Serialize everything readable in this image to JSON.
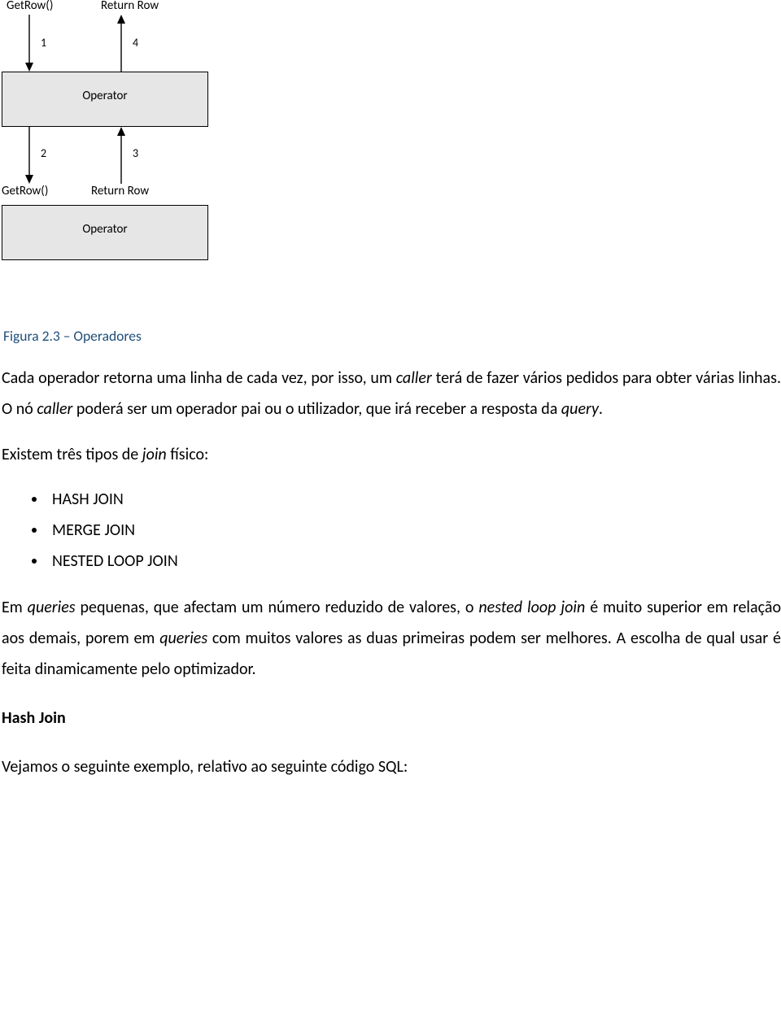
{
  "diagram": {
    "top_labels": {
      "left": "GetRow()",
      "right": "Return Row"
    },
    "mid_labels": {
      "left": "GetRow()",
      "right": "Return Row"
    },
    "op1": "Operator",
    "op2": "Operator",
    "n1": "1",
    "n2": "2",
    "n3": "3",
    "n4": "4"
  },
  "caption": "Figura 2.3 – Operadores",
  "para1a": "Cada operador retorna uma linha de cada vez, por isso, um ",
  "para1b": "caller",
  "para1c": " terá de fazer vários pedidos para obter várias linhas. O nó ",
  "para1d": "caller",
  "para1e": "  poderá ser um operador pai ou o utilizador, que irá receber a resposta da ",
  "para1f": "query",
  "para1g": ".",
  "para2a": "Existem três tipos de ",
  "para2b": "join",
  "para2c": " físico:",
  "bullet1": "HASH JOIN",
  "bullet2": "MERGE JOIN",
  "bullet3": "NESTED LOOP JOIN",
  "para3a": "Em ",
  "para3b": "queries",
  "para3c": " pequenas, que afectam um número reduzido  de valores, o ",
  "para3d": "nested loop join",
  "para3e": " é muito superior em relação aos demais, porem em ",
  "para3f": "queries",
  "para3g": " com muitos valores as duas primeiras podem ser melhores. A escolha de qual usar é feita dinamicamente pelo optimizador.",
  "heading": "Hash Join",
  "para4": "Vejamos o seguinte exemplo, relativo ao seguinte código SQL:"
}
